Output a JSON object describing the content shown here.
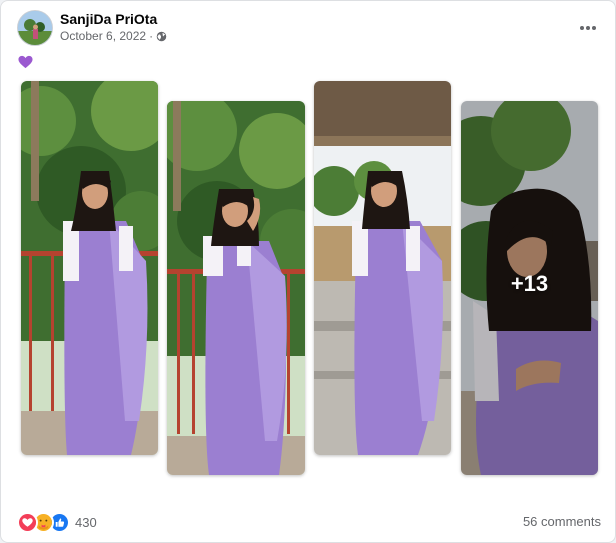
{
  "post": {
    "author": "SanjiDa PriOta",
    "date": "October 6, 2022",
    "separator": "·",
    "privacy_icon": "globe-icon",
    "more_icon": "more-horizontal-icon",
    "caption_emoji": "purple-heart-icon"
  },
  "photos": {
    "count": 4,
    "overflow_label": "+13"
  },
  "footer": {
    "reactions": [
      "love-reaction-icon",
      "care-reaction-icon",
      "like-reaction-icon"
    ],
    "reaction_count": "430",
    "comments": "56 comments"
  },
  "colors": {
    "saree": "#9b7fd1",
    "blouse": "#f4f2f7",
    "foliage": "#3d6b2e",
    "railing": "#b5432f",
    "floor": "#b8aa98",
    "purple_heart": "#9b59d0"
  }
}
